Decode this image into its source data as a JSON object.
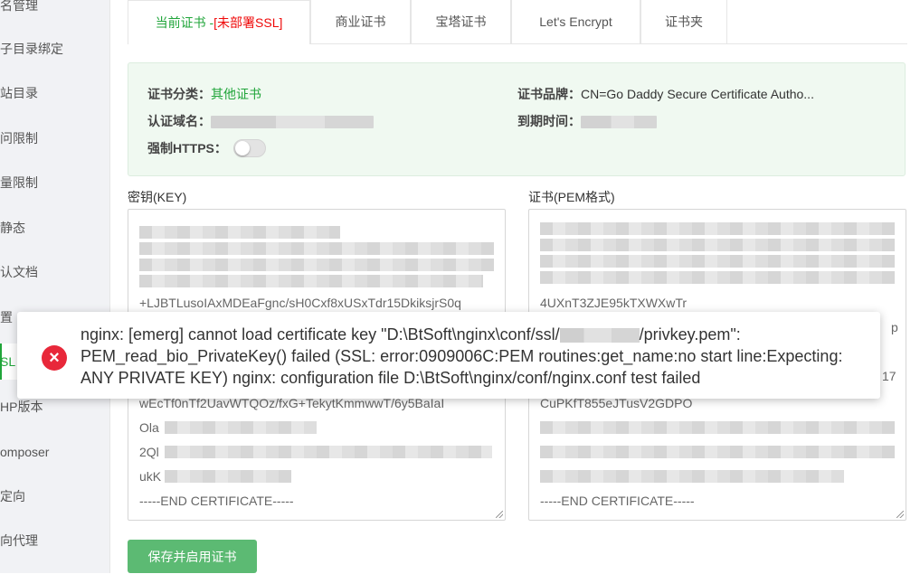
{
  "sidebar": {
    "items": [
      {
        "label": "域名管理",
        "display": "名管理"
      },
      {
        "label": "子目录绑定",
        "display": "子目录绑定"
      },
      {
        "label": "网站目录",
        "display": "站目录"
      },
      {
        "label": "访问限制",
        "display": "问限制"
      },
      {
        "label": "流量限制",
        "display": "量限制"
      },
      {
        "label": "伪静态",
        "display": "静态"
      },
      {
        "label": "默认文档",
        "display": "认文档"
      },
      {
        "label": "配置文件",
        "display": "置"
      },
      {
        "label": "SSL",
        "display": "SL"
      },
      {
        "label": "PHP版本",
        "display": "HP版本"
      },
      {
        "label": "Composer",
        "display": "omposer"
      },
      {
        "label": "重定向",
        "display": "定向"
      },
      {
        "label": "反向代理",
        "display": "向代理"
      }
    ]
  },
  "tabs": {
    "current": "当前证书 -",
    "current_status": "[未部署SSL]",
    "commercial": "商业证书",
    "baota": "宝塔证书",
    "letsencrypt": "Let's Encrypt",
    "folder": "证书夹"
  },
  "info": {
    "category_label": "证书分类：",
    "category_value": "其他证书",
    "brand_label": "证书品牌：",
    "brand_value": "CN=Go Daddy Secure Certificate Autho...",
    "domain_label": "认证域名：",
    "expiry_label": "到期时间：",
    "https_label": "强制HTTPS：",
    "https_enabled": false
  },
  "key": {
    "label": "密钥(KEY)",
    "lines": [
      "+LJBTLusoIAxMDEaFgnc/sH0Cxf8xUSxTdr15DkiksjrS0q",
      "wEcTf0nTf2UavWTQOz/fxG+TekytKmmwwT/6y5BaIaI",
      "Ola",
      "2Ql",
      "ukK",
      "-----END CERTIFICATE-----"
    ]
  },
  "cert": {
    "label": "证书(PEM格式)",
    "lines": [
      "4UXnT3ZJE95kTXWXwTr",
      "CuPKfT855eJTusV2GDPO",
      "-----END CERTIFICATE-----"
    ],
    "edge_chars": [
      "p",
      "17"
    ]
  },
  "toast": {
    "type": "error",
    "text_before": "nginx: [emerg] cannot load certificate key \"D:\\BtSoft\\nginx\\conf/ssl/",
    "text_after": "/privkey.pem\": PEM_read_bio_PrivateKey() failed (SSL: error:0909006C:PEM routines:get_name:no start line:Expecting: ANY PRIVATE KEY) nginx: configuration file D:\\BtSoft\\nginx/conf/nginx.conf test failed",
    "icon": "close-x-icon",
    "icon_glyph": "×"
  },
  "save_button": "保存并启用证书",
  "colors": {
    "accent": "#20a53a",
    "error": "#e8283a",
    "warning_text": "#ef0808",
    "button": "#5cba73"
  }
}
